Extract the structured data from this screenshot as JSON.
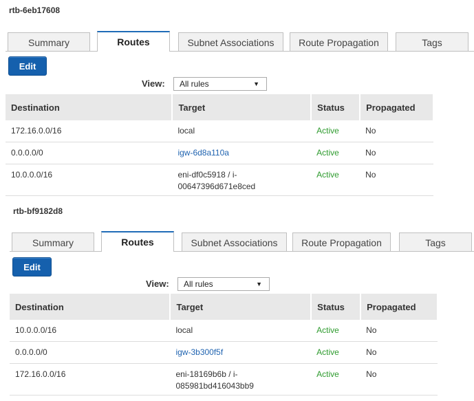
{
  "tables": [
    {
      "title": "rtb-6eb17608",
      "tabs": [
        "Summary",
        "Routes",
        "Subnet Associations",
        "Route Propagation",
        "Tags"
      ],
      "active_tab": "Routes",
      "edit_label": "Edit",
      "view_label": "View:",
      "view_value": "All rules",
      "headers": [
        "Destination",
        "Target",
        "Status",
        "Propagated"
      ],
      "rows": [
        {
          "destination": "172.16.0.0/16",
          "target": "local",
          "target_line2": "",
          "target_is_link": false,
          "status": "Active",
          "propagated": "No"
        },
        {
          "destination": "0.0.0.0/0",
          "target": "igw-6d8a110a",
          "target_line2": "",
          "target_is_link": true,
          "status": "Active",
          "propagated": "No"
        },
        {
          "destination": "10.0.0.0/16",
          "target": "eni-df0c5918 / i-",
          "target_line2": "00647396d671e8ced",
          "target_is_link": false,
          "status": "Active",
          "propagated": "No"
        }
      ]
    },
    {
      "title": "rtb-bf9182d8",
      "tabs": [
        "Summary",
        "Routes",
        "Subnet Associations",
        "Route Propagation",
        "Tags"
      ],
      "active_tab": "Routes",
      "edit_label": "Edit",
      "view_label": "View:",
      "view_value": "All rules",
      "headers": [
        "Destination",
        "Target",
        "Status",
        "Propagated"
      ],
      "rows": [
        {
          "destination": "10.0.0.0/16",
          "target": "local",
          "target_line2": "",
          "target_is_link": false,
          "status": "Active",
          "propagated": "No"
        },
        {
          "destination": "0.0.0.0/0",
          "target": "igw-3b300f5f",
          "target_line2": "",
          "target_is_link": true,
          "status": "Active",
          "propagated": "No"
        },
        {
          "destination": "172.16.0.0/16",
          "target": "eni-18169b6b / i-",
          "target_line2": "085981bd416043bb9",
          "target_is_link": false,
          "status": "Active",
          "propagated": "No"
        }
      ]
    }
  ],
  "colors": {
    "accent": "#1560ad",
    "link": "#1f63b0",
    "status_active": "#2e9b2e",
    "header_bg": "#e8e8e8"
  },
  "icons": {
    "select_caret": "chevron-down-icon"
  }
}
